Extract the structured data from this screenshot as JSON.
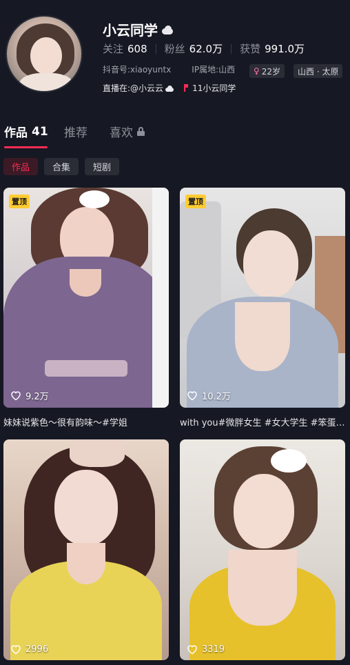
{
  "profile": {
    "name": "小云同学",
    "stats": [
      {
        "label": "关注",
        "value": "608"
      },
      {
        "label": "粉丝",
        "value": "62.0万"
      },
      {
        "label": "获赞",
        "value": "991.0万"
      }
    ],
    "douyin_id_label": "抖音号:",
    "douyin_id": "xiaoyuntx",
    "ip_label": "IP属地:",
    "ip_location": "山西",
    "age_tag": "22岁",
    "location_tag": "山西 · 太原",
    "live_label": "直播在:",
    "live_account": "@小云云",
    "group_text": "11小云同学"
  },
  "tabs": [
    {
      "label": "作品",
      "count": "41"
    },
    {
      "label": "推荐"
    },
    {
      "label": "喜欢"
    }
  ],
  "filters": [
    "作品",
    "合集",
    "短剧"
  ],
  "videos": [
    {
      "pinned_label": "置顶",
      "likes": "9.2万",
      "caption": "妹妹说紫色～很有韵味～#学姐"
    },
    {
      "pinned_label": "置顶",
      "likes": "10.2万",
      "caption": "with you#微胖女生 #女大学生 #笨蛋美女"
    },
    {
      "likes": "2996"
    },
    {
      "likes": "3319"
    }
  ],
  "colors": {
    "background": "#161823",
    "accent": "#fe2c55",
    "pin": "#ffcc33"
  }
}
